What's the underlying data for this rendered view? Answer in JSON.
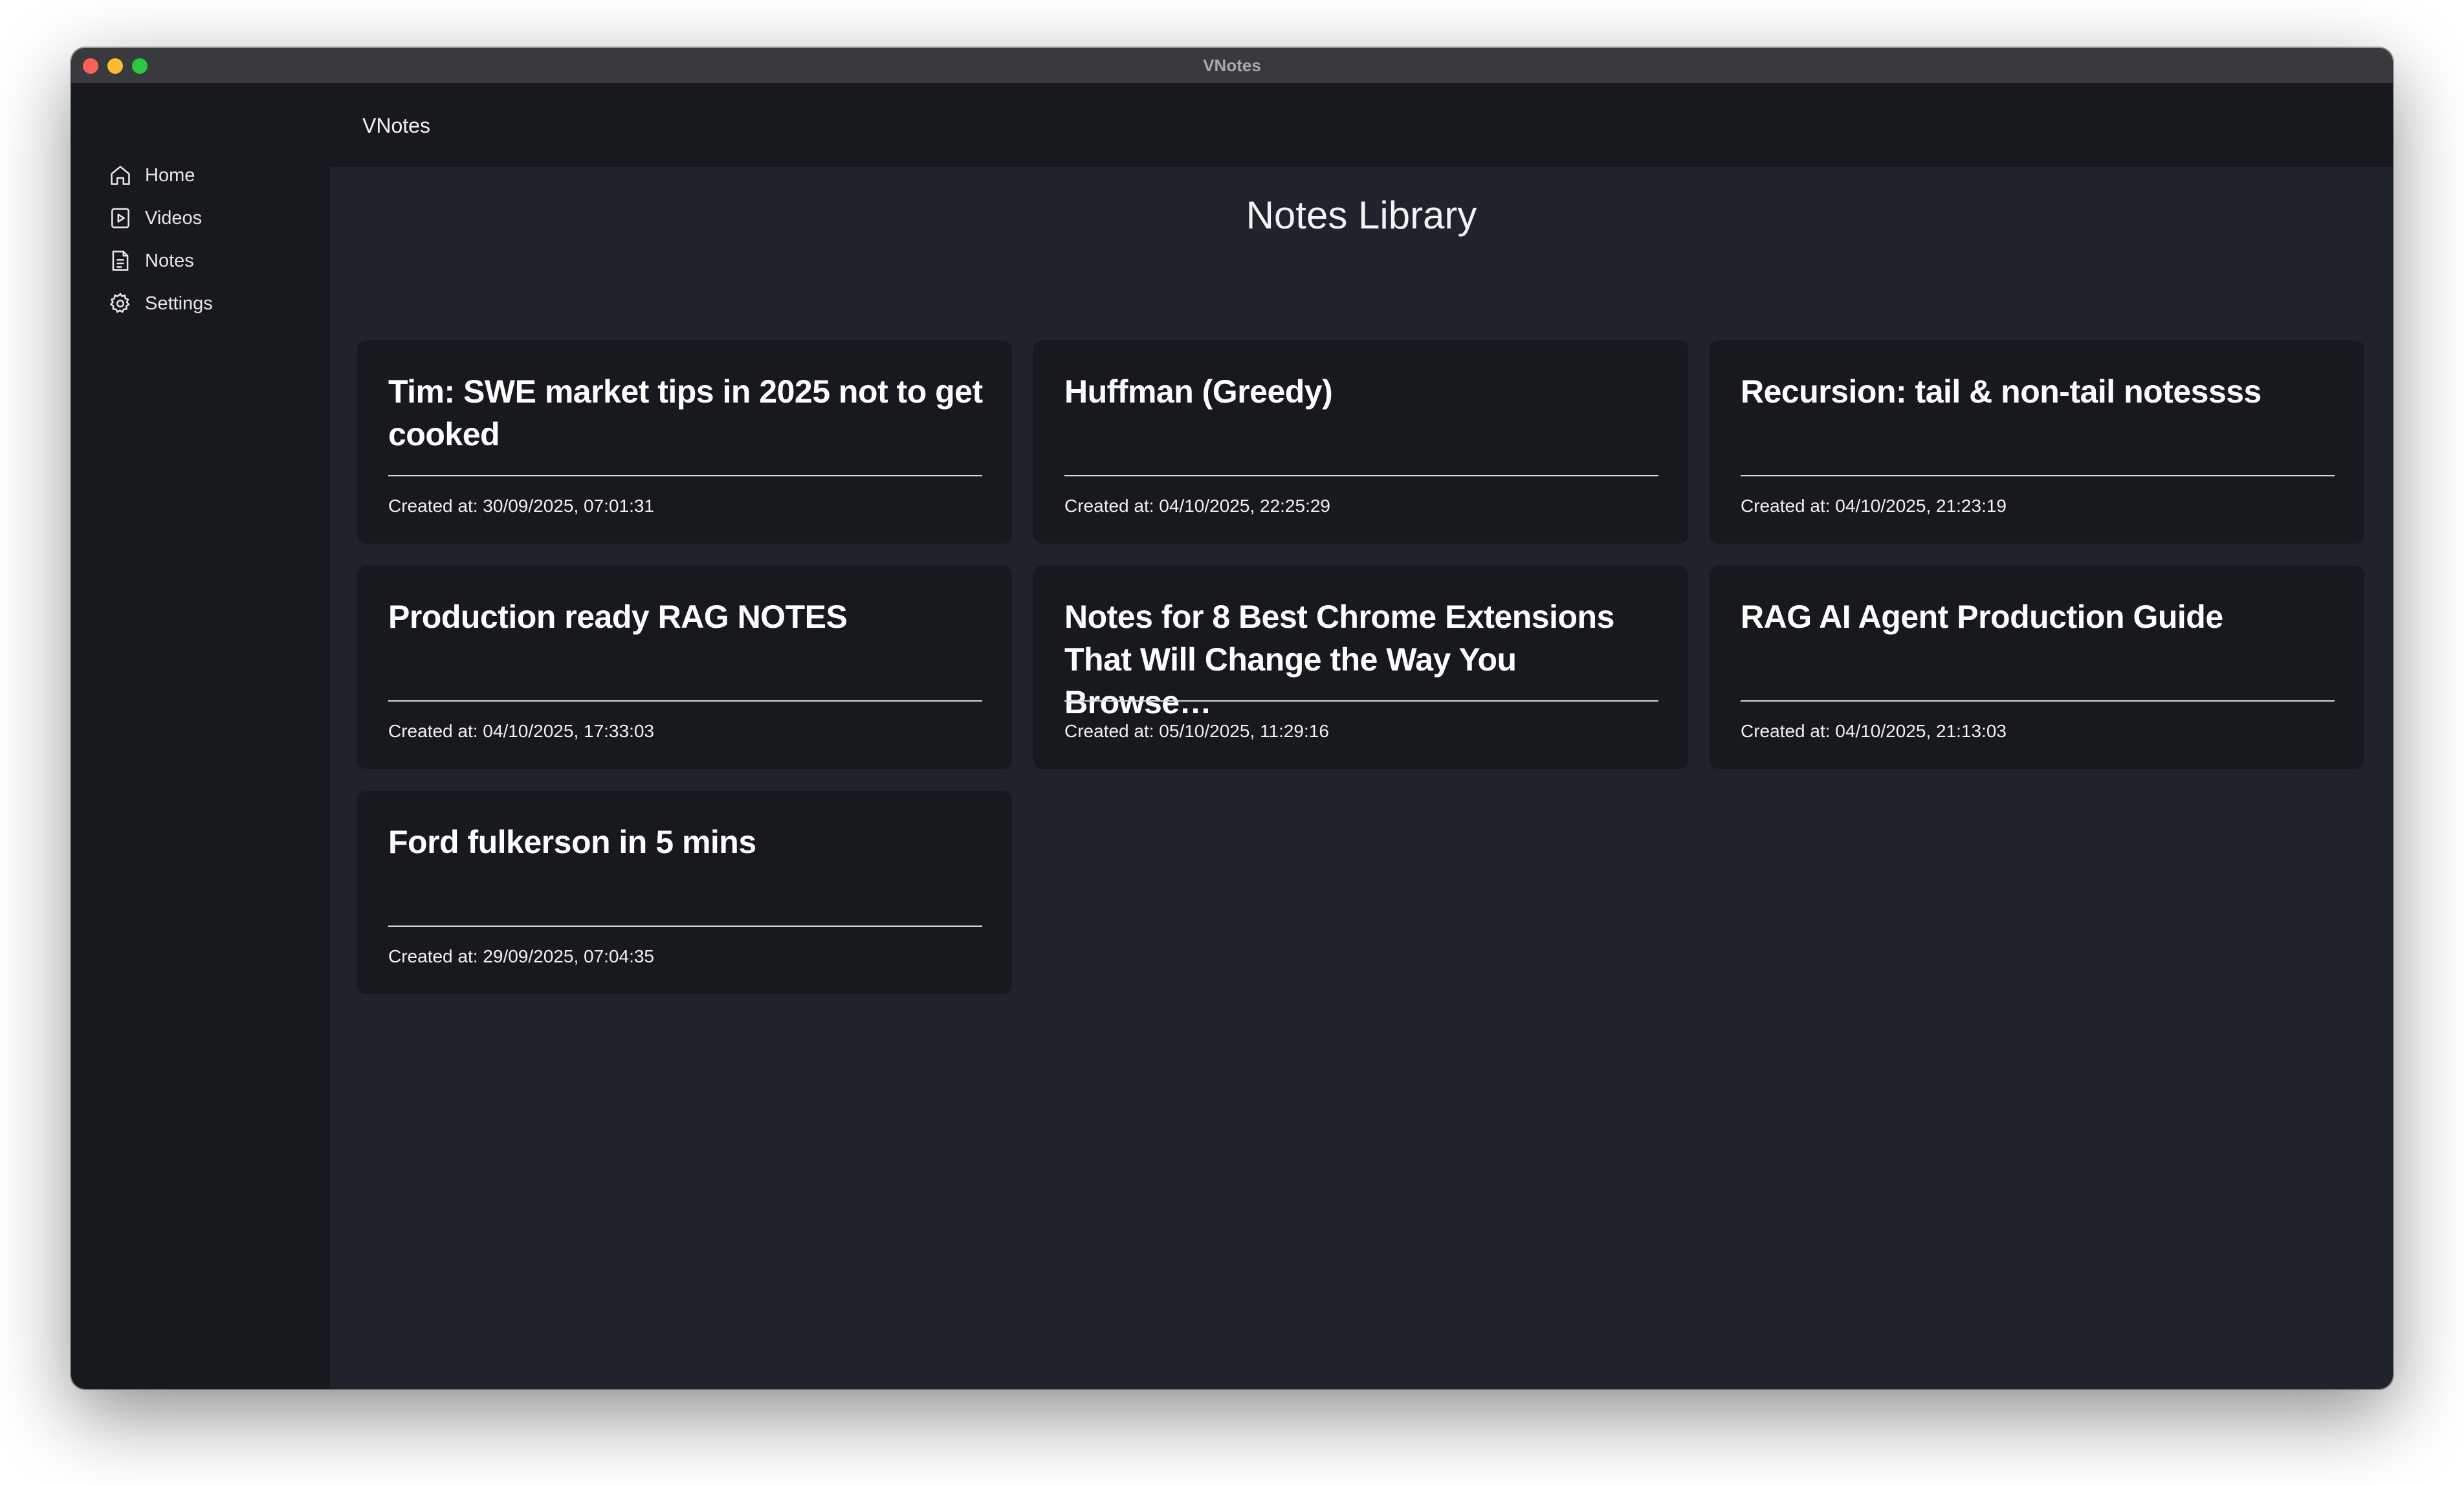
{
  "window": {
    "title": "VNotes"
  },
  "sidebar": {
    "items": [
      {
        "label": "Home",
        "icon": "home-icon"
      },
      {
        "label": "Videos",
        "icon": "video-icon"
      },
      {
        "label": "Notes",
        "icon": "note-icon"
      },
      {
        "label": "Settings",
        "icon": "gear-icon"
      }
    ]
  },
  "header": {
    "title": "VNotes"
  },
  "main": {
    "page_title": "Notes Library",
    "notes": [
      {
        "title": "Tim: SWE market tips in 2025 not to get cooked",
        "date": "Created at: 30/09/2025, 07:01:31"
      },
      {
        "title": "Huffman (Greedy)",
        "date": "Created at: 04/10/2025, 22:25:29"
      },
      {
        "title": "Recursion: tail & non-tail notessss",
        "date": "Created at: 04/10/2025, 21:23:19"
      },
      {
        "title": "Production ready RAG NOTES",
        "date": "Created at: 04/10/2025, 17:33:03"
      },
      {
        "title": "Notes for 8 Best Chrome Extensions That Will Change the Way You Browse…",
        "date": "Created at: 05/10/2025, 11:29:16"
      },
      {
        "title": "RAG AI Agent Production Guide",
        "date": "Created at: 04/10/2025, 21:13:03"
      },
      {
        "title": "Ford fulkerson in 5 mins",
        "date": "Created at: 29/09/2025, 07:04:35"
      }
    ]
  }
}
